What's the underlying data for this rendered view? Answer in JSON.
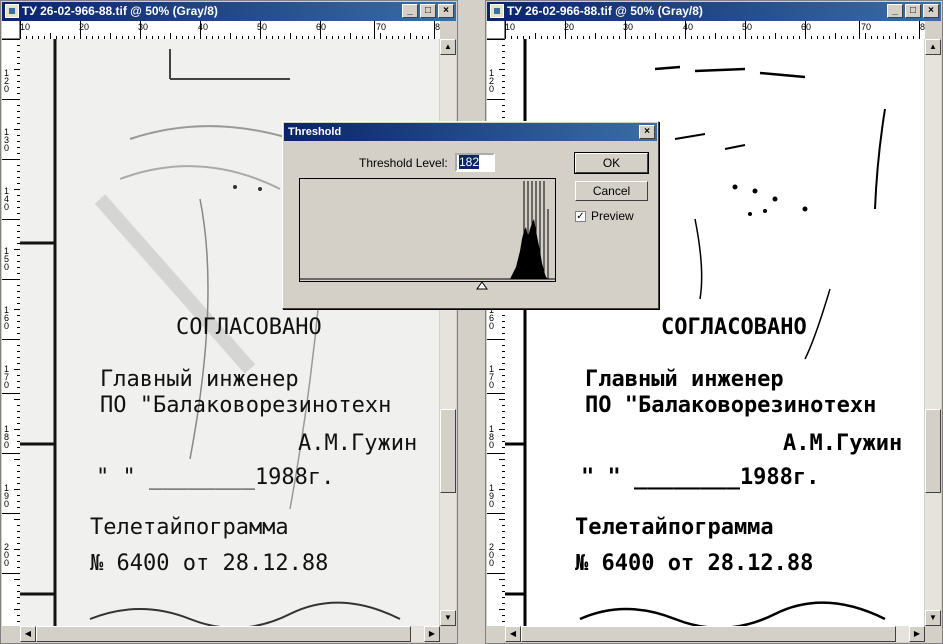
{
  "windows": {
    "left": {
      "title": "ТУ 26-02-966-88.tif @ 50% (Gray/8)"
    },
    "right": {
      "title": "ТУ 26-02-966-88.tif @ 50% (Gray/8)"
    }
  },
  "window_controls": {
    "minimize": "_",
    "maximize": "□",
    "close": "×"
  },
  "ruler": {
    "h_labels": [
      "10",
      "20",
      "30",
      "40",
      "50",
      "60",
      "70",
      "8"
    ],
    "v_labels": [
      "120",
      "130",
      "140",
      "150",
      "160",
      "170",
      "180",
      "190",
      "200"
    ]
  },
  "document": {
    "heading": "СОГЛАСОВАНО",
    "line1": "Главный инженер",
    "line2": "ПО \"Балаковорезинотехн",
    "signer": "А.М.Гужин",
    "date_line": "\"   \" ________1988г.",
    "telegram": "Телетайпограмма",
    "number_line": "№ 6400 от 28.12.88"
  },
  "dialog": {
    "title": "Threshold",
    "threshold_label": "Threshold Level:",
    "threshold_value": "182",
    "ok_label": "OK",
    "cancel_label": "Cancel",
    "preview_label": "Preview",
    "preview_checked": true
  },
  "colors": {
    "titlebar": "#0a246a",
    "face": "#d4d0c8"
  }
}
